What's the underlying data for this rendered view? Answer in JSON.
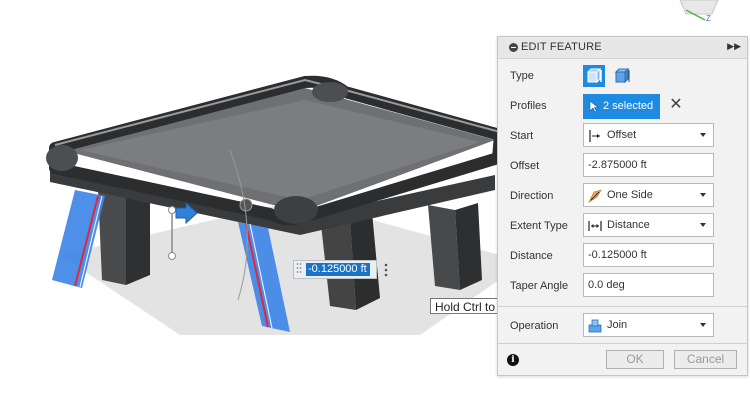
{
  "viewport": {
    "dimension_value": "-0.125000 ft",
    "tooltip": "Hold Ctrl to modify selection",
    "viewcube_axis_label": "Z"
  },
  "panel": {
    "title": "EDIT FEATURE",
    "rows": {
      "type": {
        "label": "Type"
      },
      "profiles": {
        "label": "Profiles",
        "selection": "2 selected"
      },
      "start": {
        "label": "Start",
        "value": "Offset"
      },
      "offset": {
        "label": "Offset",
        "value": "-2.875000 ft"
      },
      "direction": {
        "label": "Direction",
        "value": "One Side"
      },
      "extent_type": {
        "label": "Extent Type",
        "value": "Distance"
      },
      "distance": {
        "label": "Distance",
        "value": "-0.125000 ft"
      },
      "taper_angle": {
        "label": "Taper Angle",
        "value": "0.0 deg"
      },
      "operation": {
        "label": "Operation",
        "value": "Join"
      }
    },
    "buttons": {
      "ok": "OK",
      "cancel": "Cancel"
    }
  },
  "colors": {
    "accent": "#1e8ae0",
    "selection_blue": "#3f86e8",
    "edge_red": "#e0283a"
  },
  "icons": [
    "viewcube-icon",
    "info-icon",
    "selection-cursor-icon",
    "extrude-type-solid-icon",
    "extrude-type-thin-icon",
    "start-offset-icon",
    "direction-one-side-icon",
    "extent-distance-icon",
    "operation-join-icon",
    "clear-selection-icon",
    "expand-panel-icon"
  ]
}
